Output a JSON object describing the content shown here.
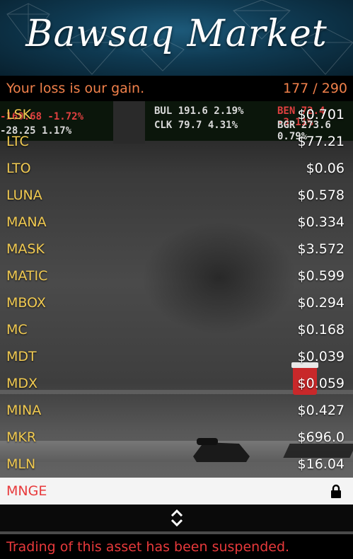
{
  "header": {
    "title": "Bawsaq Market"
  },
  "subbar": {
    "slogan": "Your loss is our gain.",
    "counter": "177 / 290"
  },
  "background_ticker": [
    {
      "text": "BUL 191.6 2.19%",
      "color": "#d9d9d9"
    },
    {
      "text": "CLK 79.7 4.31%",
      "color": "#d9d9d9"
    },
    {
      "text": "BEN 72.4 -3.11%",
      "color": "#e04040"
    },
    {
      "text": "BGR 273.6 0.79%",
      "color": "#d9d9d9"
    },
    {
      "text": "-169.68 -1.72%",
      "color": "#e04040"
    },
    {
      "text": "-28.25 1.17%",
      "color": "#d9d9d9"
    }
  ],
  "assets": [
    {
      "symbol": "LSK",
      "price": "$0.701"
    },
    {
      "symbol": "LTC",
      "price": "$77.21"
    },
    {
      "symbol": "LTO",
      "price": "$0.06"
    },
    {
      "symbol": "LUNA",
      "price": "$0.578"
    },
    {
      "symbol": "MANA",
      "price": "$0.334"
    },
    {
      "symbol": "MASK",
      "price": "$3.572"
    },
    {
      "symbol": "MATIC",
      "price": "$0.599"
    },
    {
      "symbol": "MBOX",
      "price": "$0.294"
    },
    {
      "symbol": "MC",
      "price": "$0.168"
    },
    {
      "symbol": "MDT",
      "price": "$0.039"
    },
    {
      "symbol": "MDX",
      "price": "$0.059"
    },
    {
      "symbol": "MINA",
      "price": "$0.427"
    },
    {
      "symbol": "MKR",
      "price": "$696.0"
    },
    {
      "symbol": "MLN",
      "price": "$16.04"
    }
  ],
  "selected_asset": {
    "symbol": "MNGE",
    "icon": "lock-icon",
    "locked": true
  },
  "nav": {
    "icon": "scroll-up-down-icon"
  },
  "footer": {
    "message": "Trading of this asset has been suspended."
  },
  "colors": {
    "accent_orange": "#f0804a",
    "symbol_yellow": "#f2cb52",
    "alert_red": "#e8393b",
    "header_blue": "#0f3a52"
  }
}
